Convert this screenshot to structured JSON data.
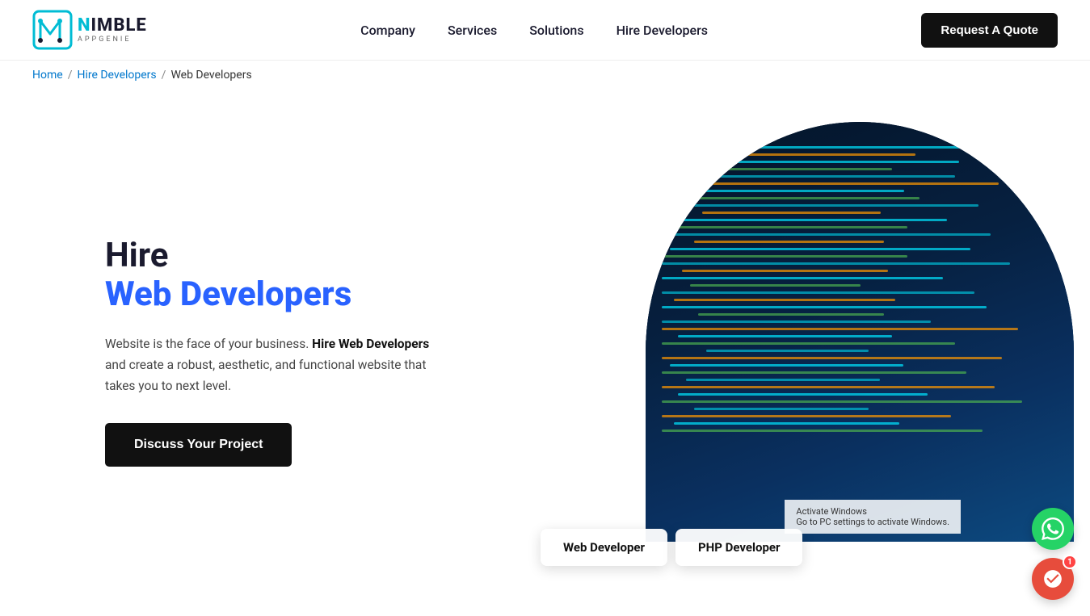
{
  "brand": {
    "name_n": "N",
    "name_rest": "IMBLE",
    "sub": "APPGENIE",
    "logo_alt": "Nimble AppGenie Logo"
  },
  "nav": {
    "links": [
      {
        "id": "company",
        "label": "Company"
      },
      {
        "id": "services",
        "label": "Services"
      },
      {
        "id": "solutions",
        "label": "Solutions"
      },
      {
        "id": "hire-developers",
        "label": "Hire Developers"
      }
    ],
    "cta_label": "Request A Quote"
  },
  "breadcrumb": {
    "home": "Home",
    "hire_developers": "Hire Developers",
    "current": "Web Developers"
  },
  "hero": {
    "title_line1": "Hire",
    "title_line2": "Web Developers",
    "description_prefix": "Website is the face of your business.",
    "description_bold": "Hire Web Developers",
    "description_suffix": "and create a robust, aesthetic, and functional website that takes you to next level.",
    "cta_label": "Discuss Your Project"
  },
  "badges": [
    {
      "id": "web-developer",
      "label": "Web Developer"
    },
    {
      "id": "php-developer",
      "label": "PHP Developer"
    }
  ],
  "windows_watermark": {
    "line1": "Activate Windows",
    "line2": "Go to PC settings to activate Windows."
  },
  "chat": {
    "whatsapp_icon": "whatsapp",
    "chat_icon": "chat",
    "badge_count": "1"
  },
  "colors": {
    "accent_blue": "#2962ff",
    "nav_text": "#1a1a2e",
    "brand_cyan": "#00bcd4",
    "btn_dark": "#111111",
    "badge_bg": "#ffffff"
  }
}
